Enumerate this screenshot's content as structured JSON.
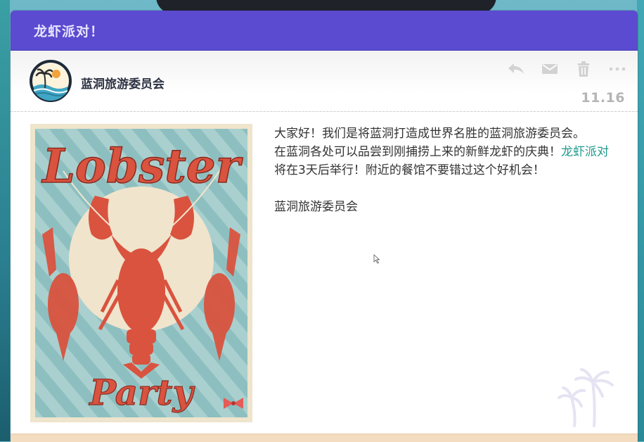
{
  "window": {
    "title": "龙虾派对！"
  },
  "header": {
    "sender": "蓝洞旅游委员会",
    "date": "11.16",
    "actions": [
      {
        "icon": "reply-icon"
      },
      {
        "icon": "envelope-icon"
      },
      {
        "icon": "trash-icon"
      },
      {
        "icon": "more-icon"
      }
    ]
  },
  "poster": {
    "title": "Lobster",
    "subtitle": "Party"
  },
  "message": {
    "line1": "大家好！我们是将蓝洞打造成世界名胜的蓝洞旅游委员会。",
    "line2_before": "在蓝洞各处可以品尝到刚捕捞上来的新鲜龙虾的庆典！",
    "line2_link": "龙虾派对",
    "line2_after": "将在3天后举行！附近的餐馆不要错过这个好机会！",
    "signature": "蓝洞旅游委员会"
  },
  "colors": {
    "titlebar": "#5a4bd0",
    "link": "#1f9b8d",
    "poster_red": "#d9533f",
    "poster_teal": "#8dbfc0"
  }
}
